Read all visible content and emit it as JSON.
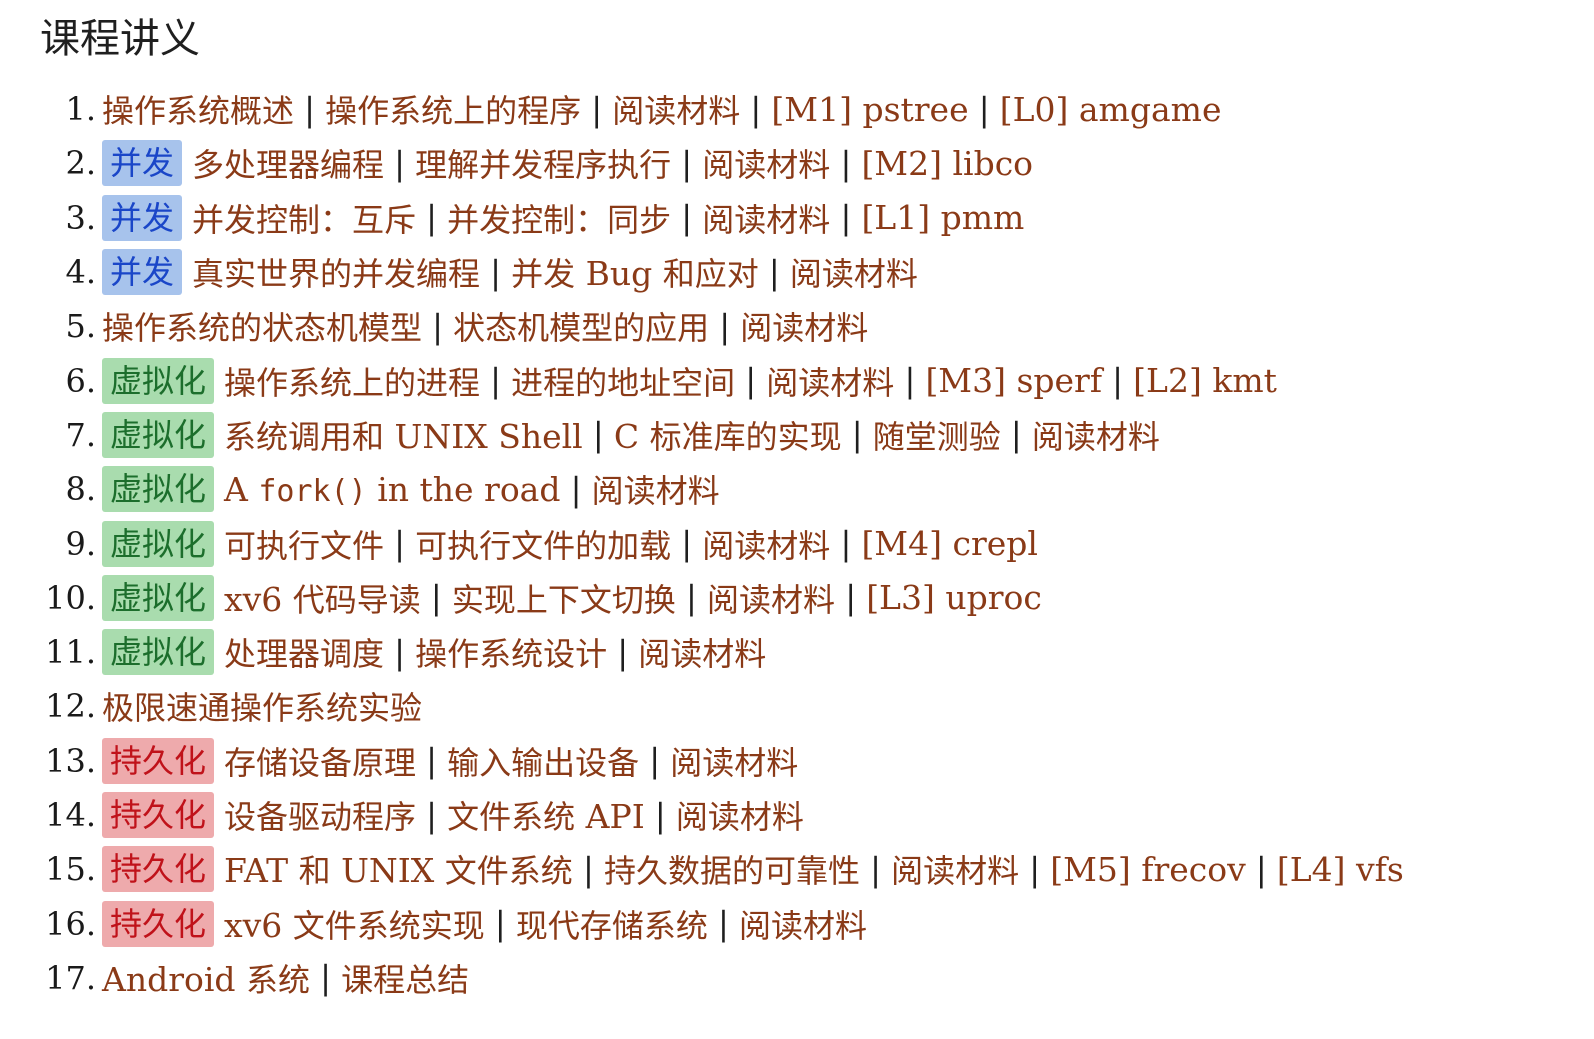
{
  "page": {
    "title": "课程讲义"
  },
  "colors": {
    "link": "#8a3a17",
    "tag_blue_bg": "#a7c3ec",
    "tag_blue_text": "#1a46c8",
    "tag_green_bg": "#a9dcae",
    "tag_green_text": "#1c6e2c",
    "tag_red_bg": "#eeaaac",
    "tag_red_text": "#c0121a"
  },
  "lectures": [
    {
      "num": "1.",
      "tag": null,
      "links": [
        "操作系统概述",
        "操作系统上的程序",
        "阅读材料",
        "[M1] pstree",
        "[L0] amgame"
      ]
    },
    {
      "num": "2.",
      "tag": {
        "label": "并发",
        "color": "blue"
      },
      "links": [
        "多处理器编程",
        "理解并发程序执行",
        "阅读材料",
        "[M2] libco"
      ]
    },
    {
      "num": "3.",
      "tag": {
        "label": "并发",
        "color": "blue"
      },
      "links": [
        "并发控制：互斥",
        "并发控制：同步",
        "阅读材料",
        "[L1] pmm"
      ]
    },
    {
      "num": "4.",
      "tag": {
        "label": "并发",
        "color": "blue"
      },
      "links": [
        "真实世界的并发编程",
        "并发 Bug 和应对",
        "阅读材料"
      ]
    },
    {
      "num": "5.",
      "tag": null,
      "links": [
        "操作系统的状态机模型",
        "状态机模型的应用",
        "阅读材料"
      ]
    },
    {
      "num": "6.",
      "tag": {
        "label": "虚拟化",
        "color": "green"
      },
      "links": [
        "操作系统上的进程",
        "进程的地址空间",
        "阅读材料",
        "[M3] sperf",
        "[L2] kmt"
      ]
    },
    {
      "num": "7.",
      "tag": {
        "label": "虚拟化",
        "color": "green"
      },
      "links": [
        "系统调用和 UNIX Shell",
        "C 标准库的实现",
        "随堂测验",
        "阅读材料"
      ]
    },
    {
      "num": "8.",
      "tag": {
        "label": "虚拟化",
        "color": "green"
      },
      "links": [
        "A fork() in the road",
        "阅读材料"
      ]
    },
    {
      "num": "9.",
      "tag": {
        "label": "虚拟化",
        "color": "green"
      },
      "links": [
        "可执行文件",
        "可执行文件的加载",
        "阅读材料",
        "[M4] crepl"
      ]
    },
    {
      "num": "10.",
      "tag": {
        "label": "虚拟化",
        "color": "green"
      },
      "links": [
        "xv6 代码导读",
        "实现上下文切换",
        "阅读材料",
        "[L3] uproc"
      ]
    },
    {
      "num": "11.",
      "tag": {
        "label": "虚拟化",
        "color": "green"
      },
      "links": [
        "处理器调度",
        "操作系统设计",
        "阅读材料"
      ]
    },
    {
      "num": "12.",
      "tag": null,
      "links": [
        "极限速通操作系统实验"
      ]
    },
    {
      "num": "13.",
      "tag": {
        "label": "持久化",
        "color": "red"
      },
      "links": [
        "存储设备原理",
        "输入输出设备",
        "阅读材料"
      ]
    },
    {
      "num": "14.",
      "tag": {
        "label": "持久化",
        "color": "red"
      },
      "links": [
        "设备驱动程序",
        "文件系统 API",
        "阅读材料"
      ]
    },
    {
      "num": "15.",
      "tag": {
        "label": "持久化",
        "color": "red"
      },
      "links": [
        "FAT 和 UNIX 文件系统",
        "持久数据的可靠性",
        "阅读材料",
        "[M5] frecov",
        "[L4] vfs"
      ]
    },
    {
      "num": "16.",
      "tag": {
        "label": "持久化",
        "color": "red"
      },
      "links": [
        "xv6 文件系统实现",
        "现代存储系统",
        "阅读材料"
      ]
    },
    {
      "num": "17.",
      "tag": null,
      "links": [
        "Android 系统",
        "课程总结"
      ]
    }
  ],
  "separator": "|"
}
